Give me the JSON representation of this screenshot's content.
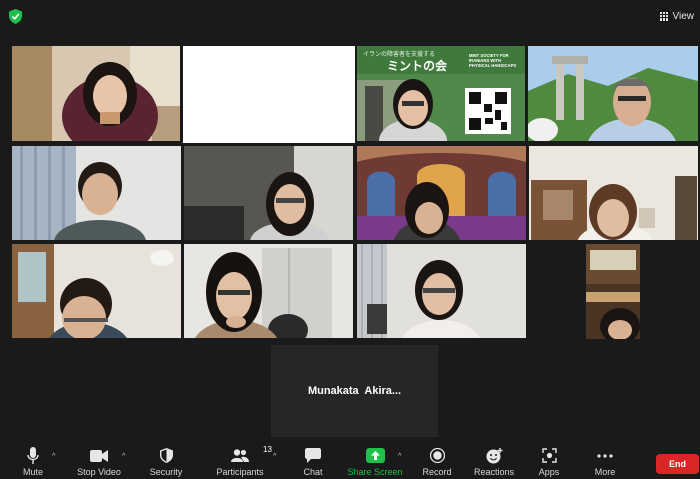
{
  "top_bar": {
    "view_label": "View"
  },
  "banner": {
    "jp_tagline": "イランの障害者を支援する",
    "title": "ミントの会",
    "en_name": "MINT SOCIETY FOR IRANIANS WITH PHYSICAL HANDICAPS"
  },
  "name_card": {
    "name": "Munakata  Akira..."
  },
  "toolbar": {
    "mute": "Mute",
    "stop_video": "Stop Video",
    "security": "Security",
    "participants": "Participants",
    "participants_count": "13",
    "chat": "Chat",
    "share_screen": "Share Screen",
    "record": "Record",
    "reactions": "Reactions",
    "apps": "Apps",
    "more": "More",
    "end": "End"
  },
  "colors": {
    "end_button": "#d92626",
    "share_screen_green": "#1fbf4b",
    "shield_green": "#1fbf4b"
  }
}
